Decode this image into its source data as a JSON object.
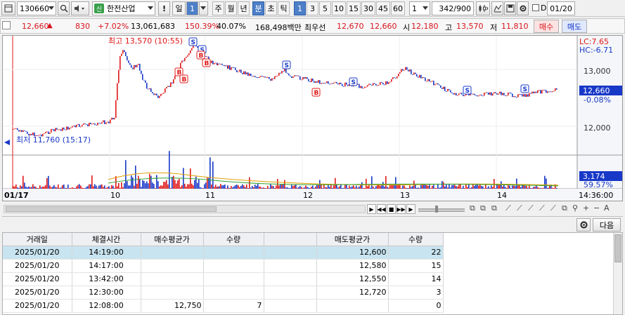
{
  "toolbar": {
    "stock_code": "130660",
    "stock_badge": "신",
    "stock_name": "한전산업",
    "alert_label": "!",
    "period_select": "일",
    "period_count": "1",
    "periods": [
      "주",
      "월",
      "년",
      "분",
      "초",
      "틱"
    ],
    "active_period": "분",
    "minute_options": [
      "1",
      "3",
      "5",
      "10",
      "15",
      "30",
      "45",
      "60"
    ],
    "active_minute": "1",
    "interval_select": "1",
    "data_count": "342",
    "data_total": "/900",
    "date_checkbox_label": "D",
    "date_value": "01/20",
    "icons": [
      "window-icon",
      "search-icon",
      "speaker-icon",
      "candle-icon",
      "crosshair-icon",
      "save-icon",
      "gear-icon"
    ]
  },
  "price_bar": {
    "current_price": "12,660",
    "change_arrow": "▲",
    "change_amount": "830",
    "change_rate": "+7.02%",
    "volume": "13,061,683",
    "volume_ratio": "150.39%",
    "turnover_rate": "40.07%",
    "trade_value": "168,498백만",
    "best_ask_label": "최우선",
    "best_ask": "12,670",
    "best_bid": "12,660",
    "open_label": "시",
    "open": "12,180",
    "high_label": "고",
    "high": "13,570",
    "low_label": "저",
    "low": "11,810",
    "buy_label": "매수",
    "sell_label": "매도"
  },
  "chart": {
    "high_annotation": "최고 13,570 (10:55)",
    "low_annotation": "최저 11,760 (15:17)",
    "lc_label": "LC:7.65",
    "hc_label": "HC:-6.71",
    "y_ticks": [
      "13,000",
      "12,000"
    ],
    "current_label": "12,660",
    "current_pct": "-0.08%",
    "volume_label": "3,174",
    "volume_pct": "59.57%",
    "x_labels": [
      "01/17",
      "10",
      "11",
      "12",
      "13",
      "14"
    ],
    "time_label": "14:36:00",
    "signal_s": "S",
    "signal_b": "B",
    "colors": {
      "up": "#e01818",
      "down": "#1838c8",
      "ma": "#e0a000",
      "ma2": "#30a030",
      "accent": "#4d7fc8"
    }
  },
  "chart_strip": {
    "zoom_in": "+",
    "zoom_out": "−",
    "font_label": "A"
  },
  "trade_table": {
    "next_label": "다음",
    "columns": [
      "거래일",
      "체결시간",
      "매수평균가",
      "수량",
      "",
      "매도평균가",
      "수량"
    ],
    "rows": [
      [
        "2025/01/20",
        "14:19:00",
        "",
        "",
        "",
        "12,600",
        "22"
      ],
      [
        "2025/01/20",
        "14:17:00",
        "",
        "",
        "",
        "12,580",
        "15"
      ],
      [
        "2025/01/20",
        "13:42:00",
        "",
        "",
        "",
        "12,550",
        "14"
      ],
      [
        "2025/01/20",
        "12:30:00",
        "",
        "",
        "",
        "12,720",
        "3"
      ],
      [
        "2025/01/20",
        "12:08:00",
        "12,750",
        "7",
        "",
        "",
        "0"
      ]
    ]
  }
}
